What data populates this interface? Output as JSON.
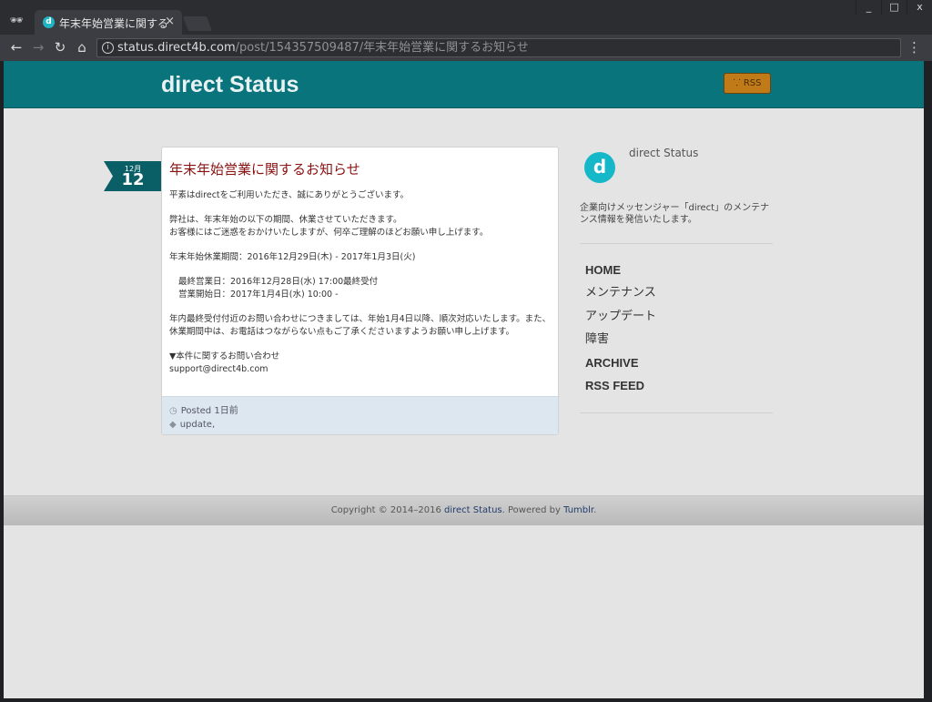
{
  "browser": {
    "tab_title": "年末年始営業に関するお",
    "tab_close": "×",
    "favicon_letter": "d",
    "win_min": "_",
    "win_max": "□",
    "win_close": "x",
    "url_host": "status.direct4b.com",
    "url_path": "/post/154357509487/年末年始営業に関するお知らせ"
  },
  "header": {
    "brand": "direct Status",
    "rss_label": "RSS"
  },
  "post": {
    "date_month": "12月",
    "date_day": "12",
    "title": "年末年始営業に関するお知らせ",
    "paragraphs": [
      "平素はdirectをご利用いただき、誠にありがとうございます。",
      "弊社は、年末年始の以下の期間、休業させていただきます。",
      "お客様にはご迷惑をおかけいたしますが、何卒ご理解のほどお願い申し上げます。",
      "年末年始休業期間：2016年12月29日(木) - 2017年1月3日(火)",
      "最終営業日：2016年12月28日(水) 17:00最終受付",
      "営業開始日：2017年1月4日(水) 10:00 -",
      "年内最終受付付近のお問い合わせにつきましては、年始1月4日以降、順次対応いたします。また、",
      "休業期間中は、お電話はつながらない点もご了承くださいますようお願い申し上げます。",
      "▼本件に関するお問い合わせ",
      "support@direct4b.com"
    ],
    "posted": "Posted 1日前",
    "tags": "update,"
  },
  "sidebar": {
    "avatar_letter": "d",
    "name": "direct Status",
    "description": "企業向けメッセンジャー「direct」のメンテナンス情報を発信いたします。",
    "nav": [
      "HOME",
      "メンテナンス",
      "アップデート",
      "障害",
      "ARCHIVE",
      "RSS FEED"
    ]
  },
  "footer": {
    "prefix": "Copyright © 2014–2016 ",
    "site": "direct Status",
    "middle": ". Powered by ",
    "platform": "Tumblr",
    "suffix": "."
  }
}
